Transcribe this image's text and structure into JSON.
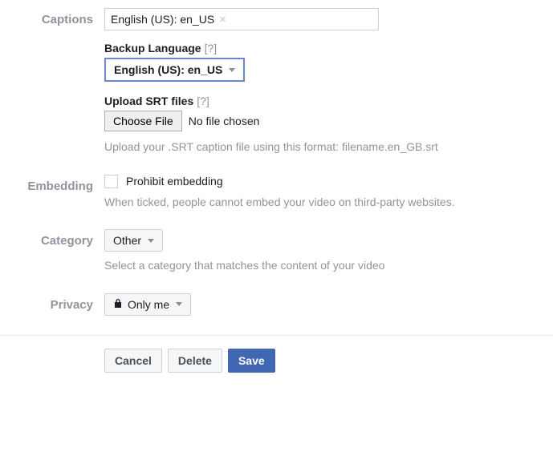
{
  "captions": {
    "label": "Captions",
    "token": "English (US): en_US",
    "token_remove_glyph": "×",
    "backup_language_label": "Backup Language",
    "backup_language_help": "[?]",
    "backup_language_value": "English (US): en_US",
    "upload_srt_label": "Upload SRT files",
    "upload_srt_help": "[?]",
    "choose_file_label": "Choose File",
    "no_file_text": "No file chosen",
    "srt_hint": "Upload your .SRT caption file using this format: filename.en_GB.srt"
  },
  "embedding": {
    "label": "Embedding",
    "checkbox_label": "Prohibit embedding",
    "hint": "When ticked, people cannot embed your video on third-party websites."
  },
  "category": {
    "label": "Category",
    "value": "Other",
    "hint": "Select a category that matches the content of your video"
  },
  "privacy": {
    "label": "Privacy",
    "value": "Only me"
  },
  "footer": {
    "cancel": "Cancel",
    "delete": "Delete",
    "save": "Save"
  }
}
